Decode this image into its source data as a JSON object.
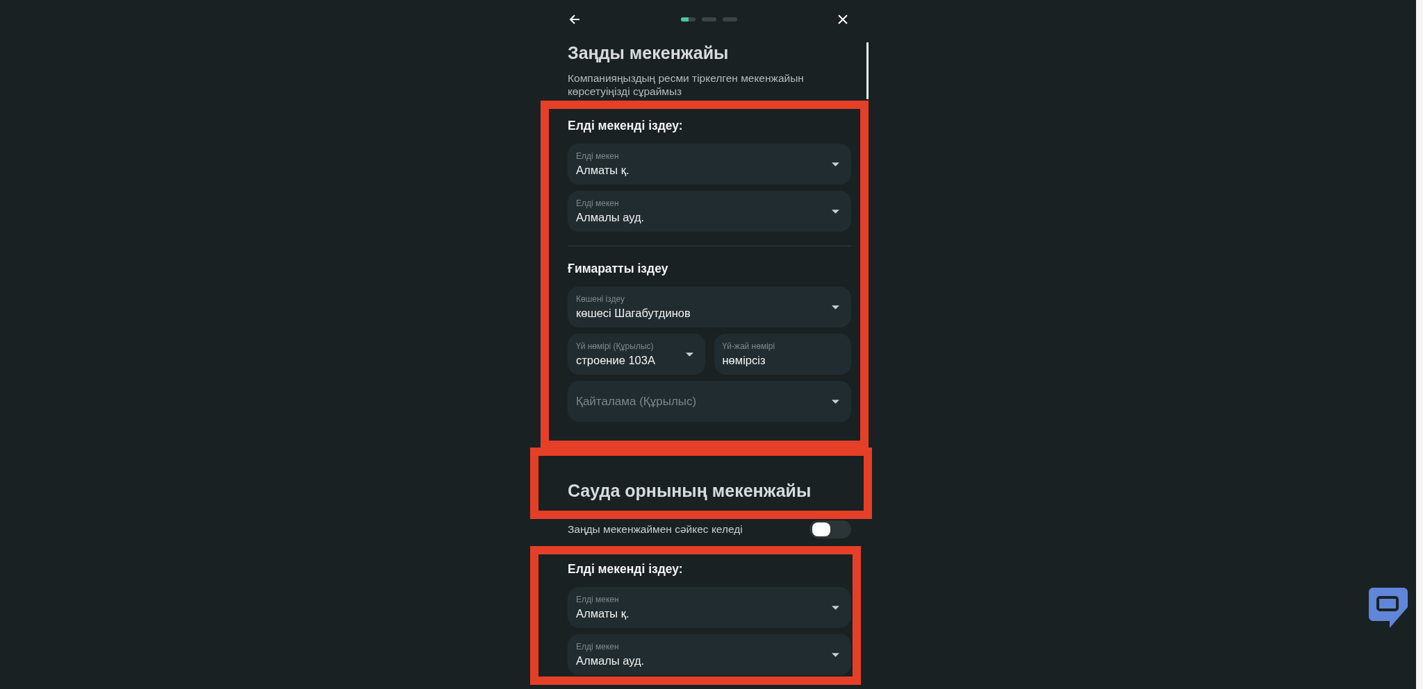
{
  "header": {
    "steps": [
      {
        "selected": true
      },
      {
        "selected": false
      },
      {
        "selected": false
      }
    ]
  },
  "legal_address": {
    "title": "Заңды мекенжайы",
    "subtitle": "Компанияңыздың ресми тіркелген мекенжайын көрсетуіңізді сұраймыз",
    "locality_heading": "Елді мекенді іздеу:",
    "locality_fields": [
      {
        "kind": "dropdown",
        "label": "Елді мекен",
        "value": "Алматы қ."
      },
      {
        "kind": "dropdown",
        "label": "Елді мекен",
        "value": "Алмалы ауд."
      }
    ],
    "building_heading": "Ғимаратты іздеу",
    "building_rows": [
      [
        {
          "kind": "dropdown",
          "label": "Көшені іздеу",
          "value": "көшесі Шагабутдинов"
        }
      ],
      [
        {
          "kind": "dropdown",
          "label": "Үй нөмірі (Құрылыс)",
          "value": "строение 103А"
        },
        {
          "kind": "text",
          "label": "Үй-жай нөмірі",
          "value": "нөмірсіз"
        }
      ],
      [
        {
          "kind": "dropdown",
          "placeholder": "Қайталама (Құрылыс)"
        }
      ]
    ]
  },
  "trade_address": {
    "title": "Сауда орнының мекенжайы",
    "same_as_legal": {
      "label": "Заңды мекенжаймен сәйкес келеді",
      "on": false
    },
    "locality_heading": "Елді мекенді іздеу:",
    "locality_fields": [
      {
        "kind": "dropdown",
        "label": "Елді мекен",
        "value": "Алматы қ."
      },
      {
        "kind": "dropdown",
        "label": "Елді мекен",
        "value": "Алмалы ауд."
      }
    ]
  }
}
